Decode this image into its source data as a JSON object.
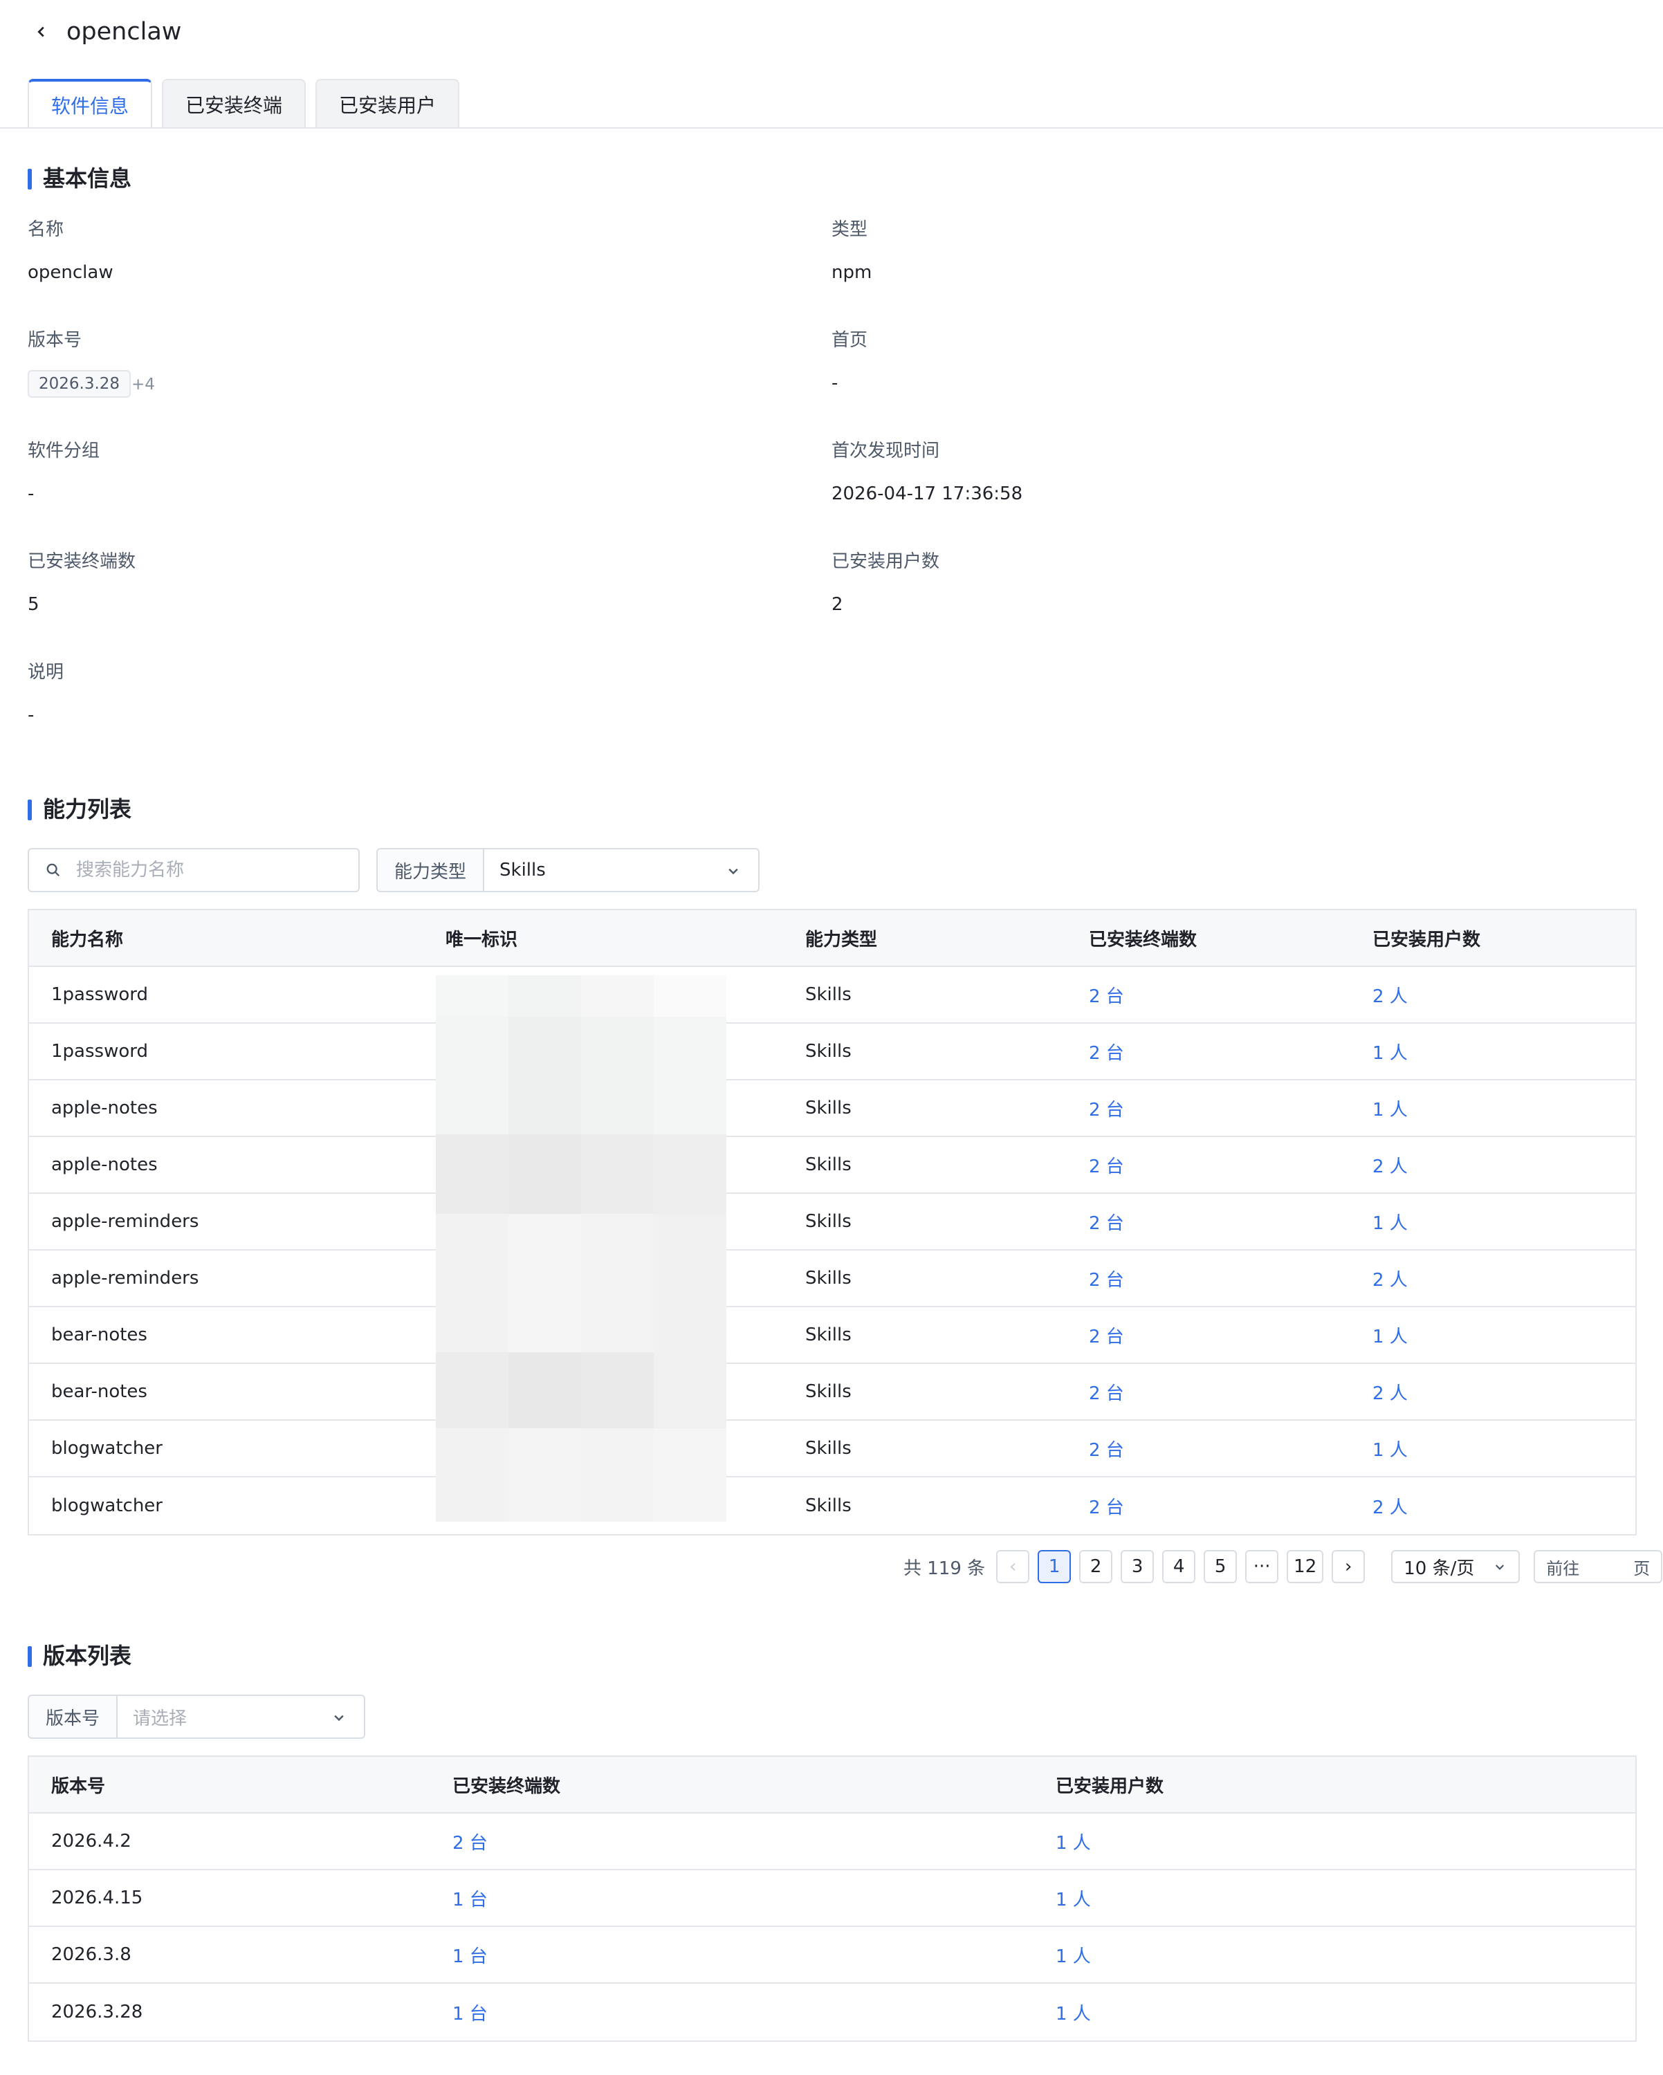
{
  "header": {
    "title": "openclaw"
  },
  "tabs": [
    {
      "label": "软件信息",
      "active": true
    },
    {
      "label": "已安装终端",
      "active": false
    },
    {
      "label": "已安装用户",
      "active": false
    }
  ],
  "basic_info": {
    "section_title": "基本信息",
    "name_label": "名称",
    "name_value": "openclaw",
    "type_label": "类型",
    "type_value": "npm",
    "version_label": "版本号",
    "version_tag": "2026.3.28",
    "version_more": "+4",
    "homepage_label": "首页",
    "homepage_value": "-",
    "group_label": "软件分组",
    "group_value": "-",
    "first_seen_label": "首次发现时间",
    "first_seen_value": "2026-04-17 17:36:58",
    "terminals_label": "已安装终端数",
    "terminals_value": "5",
    "users_label": "已安装用户数",
    "users_value": "2",
    "desc_label": "说明",
    "desc_value": "-"
  },
  "capabilities": {
    "section_title": "能力列表",
    "search_placeholder": "搜索能力名称",
    "filter_label": "能力类型",
    "filter_value": "Skills",
    "columns": [
      "能力名称",
      "唯一标识",
      "能力类型",
      "已安装终端数",
      "已安装用户数"
    ],
    "rows": [
      {
        "name": "1password",
        "type": "Skills",
        "terminals": "2 台",
        "users": "2 人"
      },
      {
        "name": "1password",
        "type": "Skills",
        "terminals": "2 台",
        "users": "1 人"
      },
      {
        "name": "apple-notes",
        "type": "Skills",
        "terminals": "2 台",
        "users": "1 人"
      },
      {
        "name": "apple-notes",
        "type": "Skills",
        "terminals": "2 台",
        "users": "2 人"
      },
      {
        "name": "apple-reminders",
        "type": "Skills",
        "terminals": "2 台",
        "users": "1 人"
      },
      {
        "name": "apple-reminders",
        "type": "Skills",
        "terminals": "2 台",
        "users": "2 人"
      },
      {
        "name": "bear-notes",
        "type": "Skills",
        "terminals": "2 台",
        "users": "1 人"
      },
      {
        "name": "bear-notes",
        "type": "Skills",
        "terminals": "2 台",
        "users": "2 人"
      },
      {
        "name": "blogwatcher",
        "type": "Skills",
        "terminals": "2 台",
        "users": "1 人"
      },
      {
        "name": "blogwatcher",
        "type": "Skills",
        "terminals": "2 台",
        "users": "2 人"
      }
    ],
    "pagination": {
      "total_text": "共 119 条",
      "prev": "‹",
      "pages": [
        "1",
        "2",
        "3",
        "4",
        "5"
      ],
      "ellipsis": "···",
      "last_page": "12",
      "next": "›",
      "page_size": "10 条/页",
      "goto_label": "前往",
      "goto_suffix": "页"
    }
  },
  "versions": {
    "section_title": "版本列表",
    "filter_label": "版本号",
    "filter_placeholder": "请选择",
    "columns": [
      "版本号",
      "已安装终端数",
      "已安装用户数"
    ],
    "rows": [
      {
        "version": "2026.4.2",
        "terminals": "2 台",
        "users": "1 人"
      },
      {
        "version": "2026.4.15",
        "terminals": "1 台",
        "users": "1 人"
      },
      {
        "version": "2026.3.8",
        "terminals": "1 台",
        "users": "1 人"
      },
      {
        "version": "2026.3.28",
        "terminals": "1 台",
        "users": "1 人"
      }
    ]
  },
  "colors": {
    "accent": "#2f6ee6",
    "border": "#e5e6eb",
    "header_bg": "#f7f8fa"
  }
}
